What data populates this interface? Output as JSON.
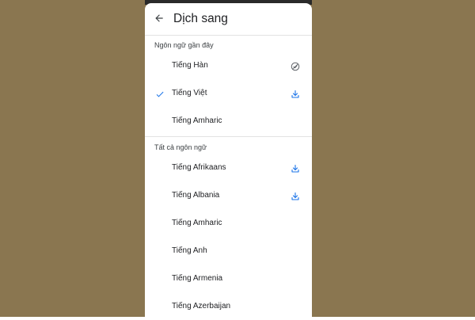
{
  "colors": {
    "background": "#8a7650",
    "accent": "#1a73e8",
    "text": "#202124",
    "muted_icon": "#5f6368"
  },
  "header": {
    "title": "Dịch sang",
    "back_icon": "arrow-left-icon"
  },
  "recent": {
    "label": "Ngôn ngữ gần đây",
    "items": [
      {
        "label": "Tiếng Hàn",
        "selected": false,
        "trailing_icon": "downloaded-check-circle-icon"
      },
      {
        "label": "Tiếng Việt",
        "selected": true,
        "trailing_icon": "download-icon"
      },
      {
        "label": "Tiếng Amharic",
        "selected": false,
        "trailing_icon": ""
      }
    ]
  },
  "all": {
    "label": "Tất cả ngôn ngữ",
    "items": [
      {
        "label": "Tiếng Afrikaans",
        "trailing_icon": "download-icon"
      },
      {
        "label": "Tiếng Albania",
        "trailing_icon": "download-icon"
      },
      {
        "label": "Tiếng Amharic",
        "trailing_icon": ""
      },
      {
        "label": "Tiếng Anh",
        "trailing_icon": ""
      },
      {
        "label": "Tiếng Armenia",
        "trailing_icon": ""
      },
      {
        "label": "Tiếng Azerbaijan",
        "trailing_icon": ""
      }
    ]
  }
}
